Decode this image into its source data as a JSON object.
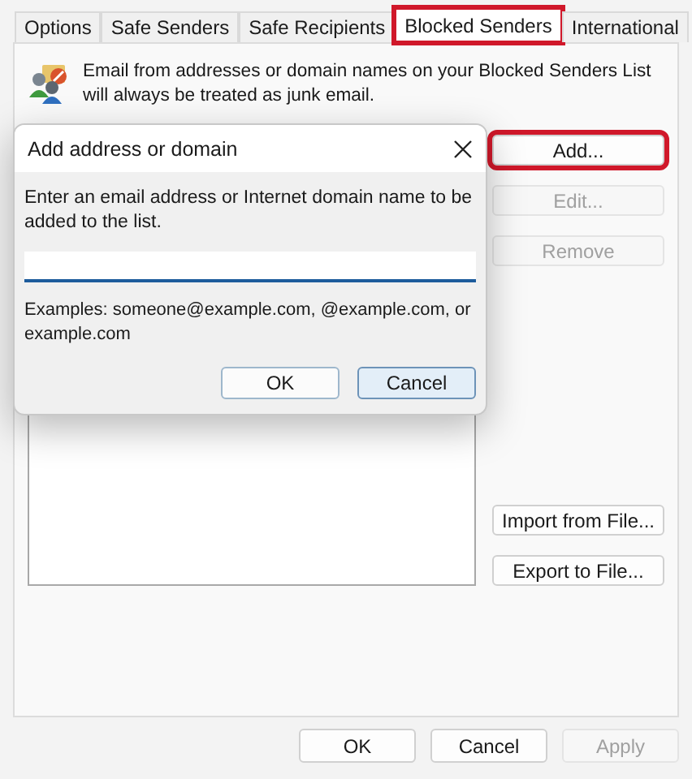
{
  "tabs": [
    {
      "label": "Options",
      "selected": false,
      "highlighted": false
    },
    {
      "label": "Safe Senders",
      "selected": false,
      "highlighted": false
    },
    {
      "label": "Safe Recipients",
      "selected": false,
      "highlighted": false
    },
    {
      "label": "Blocked Senders",
      "selected": true,
      "highlighted": true
    },
    {
      "label": "International",
      "selected": false,
      "highlighted": false
    }
  ],
  "description": "Email from addresses or domain names on your Blocked Senders List will always be treated as junk email.",
  "side_buttons": [
    {
      "label": "Add...",
      "disabled": false,
      "highlighted": true
    },
    {
      "label": "Edit...",
      "disabled": true,
      "highlighted": false
    },
    {
      "label": "Remove",
      "disabled": true,
      "highlighted": false
    }
  ],
  "file_buttons": [
    {
      "label": "Import from File...",
      "disabled": false
    },
    {
      "label": "Export to File...",
      "disabled": false
    }
  ],
  "footer_buttons": [
    {
      "label": "OK",
      "disabled": false
    },
    {
      "label": "Cancel",
      "disabled": false
    },
    {
      "label": "Apply",
      "disabled": true
    }
  ],
  "dialog": {
    "title": "Add address or domain",
    "prompt": "Enter an email address or Internet domain name to be added to the list.",
    "examples": "Examples: someone@example.com, @example.com, or example.com",
    "buttons": [
      {
        "label": "OK",
        "focused": false
      },
      {
        "label": "Cancel",
        "focused": true
      }
    ]
  }
}
